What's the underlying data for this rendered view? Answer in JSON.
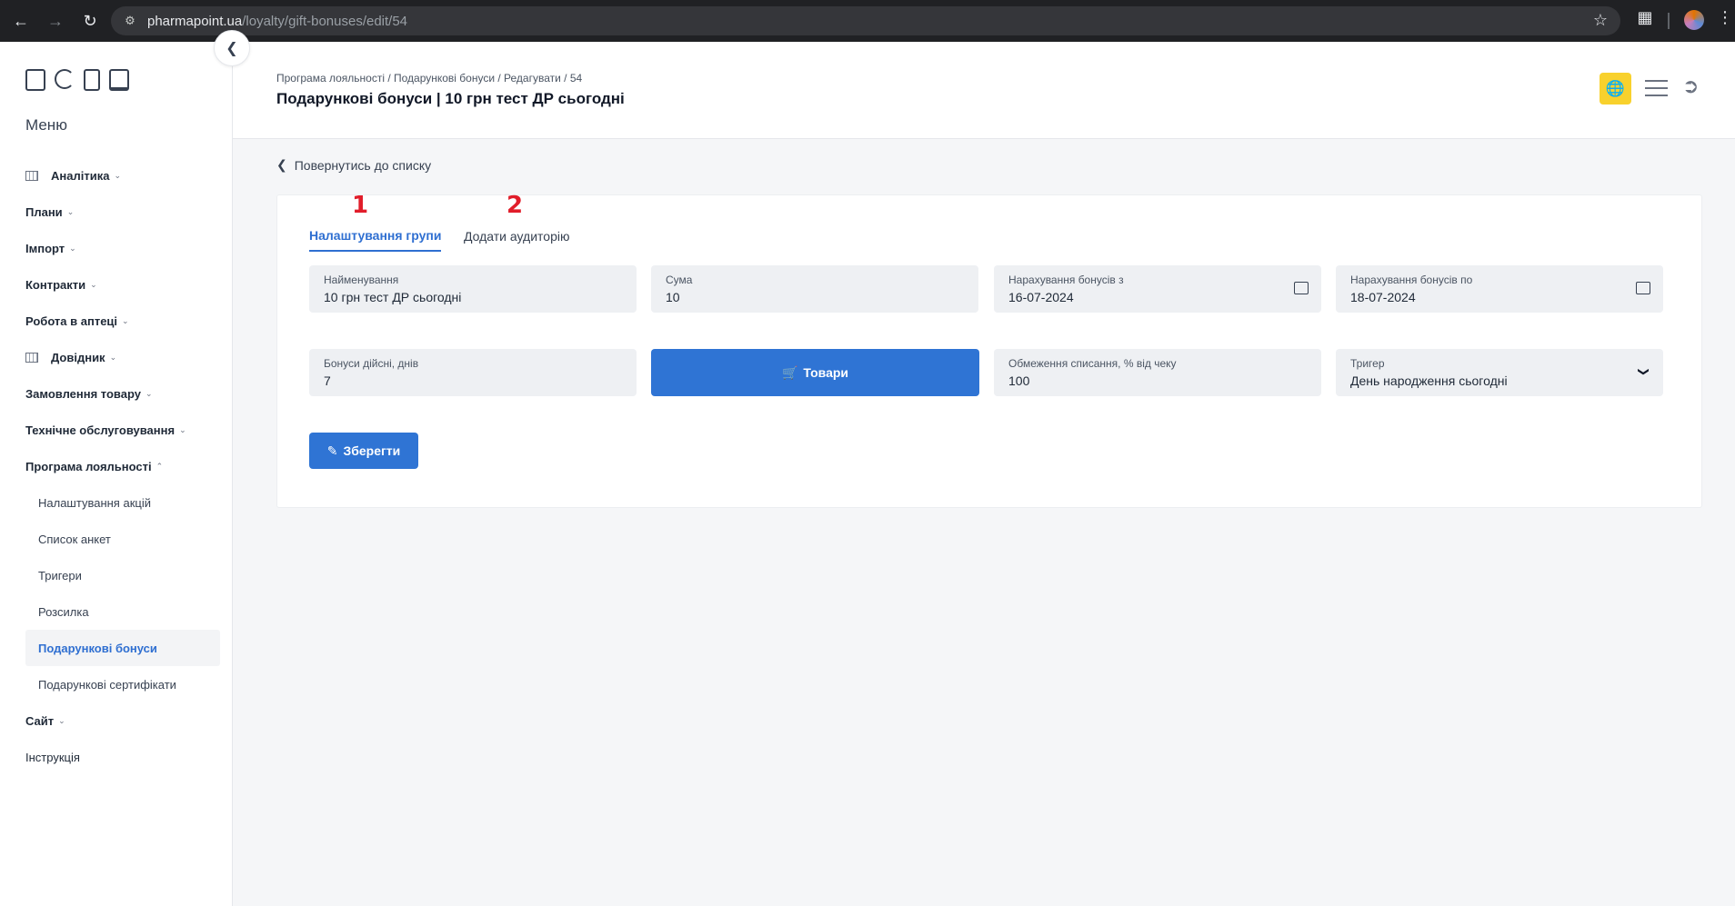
{
  "browser": {
    "url_host": "pharmapoint.ua",
    "url_path": "/loyalty/gift-bonuses/edit/54",
    "back_icon": "arrow-left-icon",
    "forward_icon": "arrow-right-icon",
    "reload_icon": "reload-icon"
  },
  "sidebar": {
    "menu_title": "Меню",
    "items": [
      {
        "label": "Аналітика",
        "has_icon": true
      },
      {
        "label": "Плани"
      },
      {
        "label": "Імпорт"
      },
      {
        "label": "Контракти"
      },
      {
        "label": "Робота в аптеці"
      },
      {
        "label": "Довідник",
        "has_icon": true
      },
      {
        "label": "Замовлення товару"
      },
      {
        "label": "Технічне обслуговування"
      },
      {
        "label": "Програма лояльності"
      }
    ],
    "loyalty_sub": [
      {
        "label": "Налаштування акцій"
      },
      {
        "label": "Список анкет"
      },
      {
        "label": "Тригери"
      },
      {
        "label": "Розсилка"
      },
      {
        "label": "Подарункові бонуси"
      },
      {
        "label": "Подарункові сертифікати"
      }
    ],
    "site": "Сайт",
    "instruction": "Інструкція"
  },
  "header": {
    "breadcrumb": "Програма лояльності / Подарункові бонуси / Редагувати / 54",
    "title": "Подарункові бонуси | 10 грн тест ДР сьогодні"
  },
  "content": {
    "back_link": "Повернутись до списку",
    "tabs": [
      {
        "label": "Налаштування групи",
        "marker": "1"
      },
      {
        "label": "Додати аудиторію",
        "marker": "2"
      }
    ],
    "fields": {
      "name": {
        "label": "Найменування",
        "value": "10 грн тест ДР сьогодні"
      },
      "sum": {
        "label": "Сума",
        "value": "10"
      },
      "from": {
        "label": "Нарахування бонусів з",
        "value": "16-07-2024"
      },
      "to": {
        "label": "Нарахування бонусів по",
        "value": "18-07-2024"
      },
      "valid_days": {
        "label": "Бонуси дійсні, днів",
        "value": "7"
      },
      "limit": {
        "label": "Обмеження списання, % від чеку",
        "value": "100"
      },
      "trigger": {
        "label": "Тригер",
        "value": "День народження сьогодні"
      }
    },
    "products_button": "Товари",
    "save_button": "Зберегти"
  },
  "colors": {
    "accent": "#2f74d4",
    "active_tab": "#2f6fd1",
    "marker": "#e11d2a",
    "globe_bg": "#f8d12d"
  }
}
